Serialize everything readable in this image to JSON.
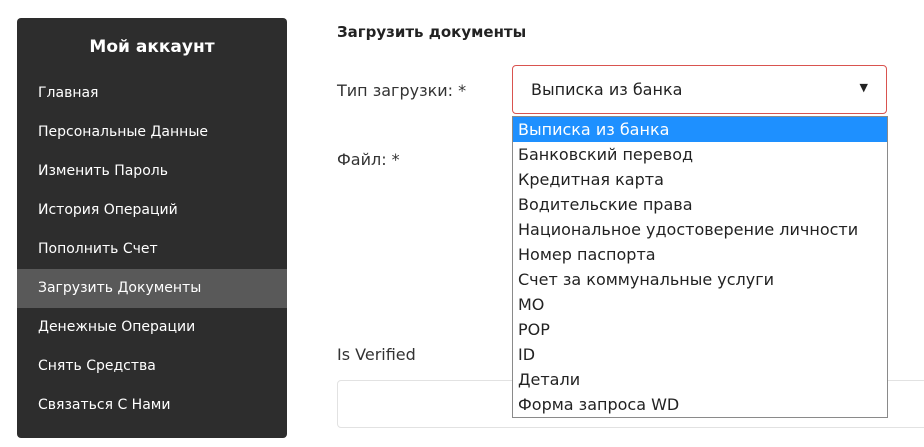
{
  "sidebar": {
    "title": "Мой аккаунт",
    "items": [
      {
        "label": "Главная"
      },
      {
        "label": "Персональные Данные"
      },
      {
        "label": "Изменить Пароль"
      },
      {
        "label": "История Операций"
      },
      {
        "label": "Пополнить Счет"
      },
      {
        "label": "Загрузить Документы"
      },
      {
        "label": "Денежные Операции"
      },
      {
        "label": "Снять Средства"
      },
      {
        "label": "Связаться С Нами"
      }
    ],
    "active_index": 5
  },
  "main": {
    "section_title": "Загрузить документы",
    "upload_type_label": "Тип загрузки: *",
    "upload_type_value": "Выписка из банка",
    "file_label": "Файл: *",
    "is_verified_label": "Is Verified"
  },
  "dropdown": {
    "options": [
      "Выписка из банка",
      "Банковский перевод",
      "Кредитная карта",
      "Водительские права",
      "Национальное удостоверение личности",
      "Номер паспорта",
      "Счет за коммунальные услуги",
      "MO",
      "POP",
      "ID",
      "Детали",
      "Форма запроса WD"
    ],
    "selected_index": 0
  },
  "colors": {
    "sidebar_bg": "#2d2d2d",
    "sidebar_active": "#595959",
    "select_border": "#d9534f",
    "option_highlight": "#1e90ff"
  },
  "icons": {
    "select_arrow": "caret-down-icon"
  }
}
